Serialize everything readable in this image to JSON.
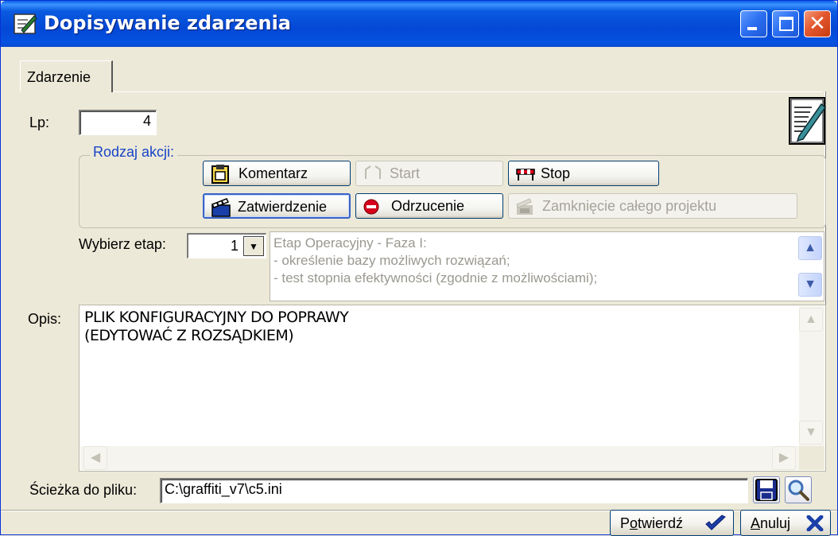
{
  "window": {
    "title": "Dopisywanie zdarzenia",
    "controls": {
      "minimize": "minimize",
      "maximize": "maximize",
      "close": "✕"
    }
  },
  "tabs": [
    {
      "label": "Zdarzenie",
      "active": true
    }
  ],
  "lp": {
    "label": "Lp:",
    "value": "4"
  },
  "rodzaj_akcji": {
    "legend": "Rodzaj akcji:",
    "buttons": [
      {
        "label": "Komentarz",
        "icon": "clipboard-icon",
        "state": "normal"
      },
      {
        "label": "Start",
        "icon": "start-arrows-icon",
        "state": "disabled"
      },
      {
        "label": "Stop",
        "icon": "barrier-icon",
        "state": "normal"
      },
      {
        "label": "Zatwierdzenie",
        "icon": "clapperboard-icon",
        "state": "selected"
      },
      {
        "label": "Odrzucenie",
        "icon": "no-entry-icon",
        "state": "normal"
      },
      {
        "label": "Zamknięcie całego projektu",
        "icon": "close-project-icon",
        "state": "disabled"
      }
    ]
  },
  "etap": {
    "label": "Wybierz etap:",
    "value": "1",
    "description": [
      "Etap Operacyjny - Faza I:",
      "- określenie bazy możliwych rozwiązań;",
      "- test stopnia efektywności (zgodnie z możliwościami);"
    ]
  },
  "opis": {
    "label": "Opis:",
    "lines": [
      "PLIK KONFIGURACYJNY DO POPRAWY",
      "(EDYTOWAĆ Z ROZSĄDKIEM)"
    ]
  },
  "sciezka": {
    "label": "Ścieżka do pliku:",
    "value": "C:\\graffiti_v7\\c5.ini"
  },
  "footer": {
    "confirm_prefix": "P",
    "confirm_underlined": "o",
    "confirm_suffix": "twierdź",
    "cancel_underlined": "A",
    "cancel_suffix": "nuluj"
  },
  "colors": {
    "titlebar": "#0448d6",
    "legend": "#1945c8",
    "accent_check": "#1a3fa8"
  }
}
